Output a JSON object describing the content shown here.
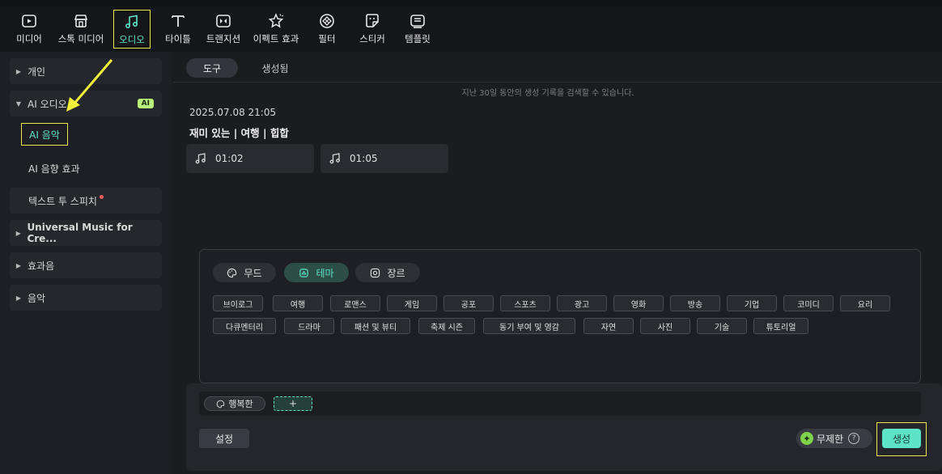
{
  "toolbar": {
    "items": [
      {
        "label": "미디어",
        "icon": "media-icon"
      },
      {
        "label": "스톡 미디어",
        "icon": "stock-media-icon"
      },
      {
        "label": "오디오",
        "icon": "audio-note-icon",
        "active": true
      },
      {
        "label": "타이틀",
        "icon": "title-t-icon"
      },
      {
        "label": "트랜지션",
        "icon": "transition-icon"
      },
      {
        "label": "이펙트 효과",
        "icon": "effect-star-icon"
      },
      {
        "label": "필터",
        "icon": "filter-icon"
      },
      {
        "label": "스티커",
        "icon": "sticker-icon"
      },
      {
        "label": "템플릿",
        "icon": "template-icon"
      }
    ]
  },
  "sidebar": {
    "personal": "개인",
    "ai_audio": "AI 오디오",
    "ai_badge": "AI",
    "ai_music": "AI 음악",
    "ai_sfx": "AI 음향 효과",
    "tts": "텍스트 투 스피치",
    "universal": "Universal Music for Cre...",
    "sfx": "효과음",
    "music": "음악"
  },
  "main": {
    "tabs": {
      "tools": "도구",
      "generated": "생성됨"
    },
    "hint": "지난 30일 동안의 생성 기록을 검색할 수 있습니다.",
    "history": {
      "date": "2025.07.08 21:05",
      "title": "재미 있는 | 여행 | 힙합",
      "clips": [
        "01:02",
        "01:05"
      ]
    },
    "panel": {
      "tabs": {
        "mood": "무드",
        "theme": "테마",
        "genre": "장르"
      },
      "chips_row1": [
        "브이로그",
        "여행",
        "로맨스",
        "게임",
        "공포",
        "스포츠",
        "광고",
        "영화",
        "방송",
        "기업",
        "코미디",
        "요리"
      ],
      "chips_row2": [
        "다큐멘터리",
        "드라마",
        "패션 및 뷰티",
        "축제 시즌",
        "동기 부여 및 영감",
        "자연",
        "사진",
        "기술",
        "튜토리얼"
      ]
    },
    "prompt": {
      "tag": "행복한",
      "add": "+"
    },
    "settings": "설정",
    "unlimited": "무제한",
    "help": "?",
    "generate": "생성"
  },
  "colors": {
    "accent": "#5fe3c7",
    "highlight": "#e8e84a",
    "arrow": "#f0f03a"
  }
}
